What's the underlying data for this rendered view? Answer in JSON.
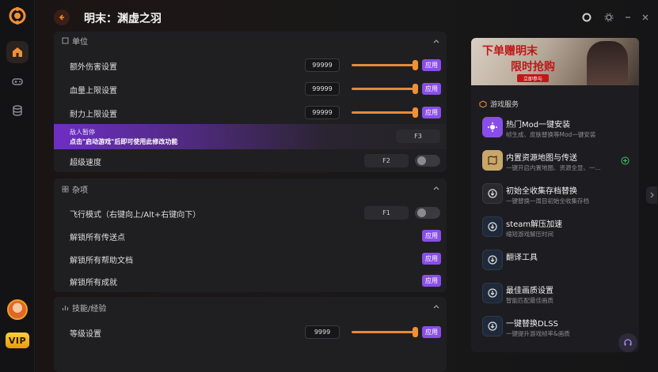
{
  "colors": {
    "accent": "#8a4ee8",
    "slider": "#e58a3a",
    "brand": "#f29035"
  },
  "header": {
    "title": "明末：渊虚之羽"
  },
  "sidebar": {
    "vip_label": "VIP"
  },
  "sections": {
    "unit": {
      "title": "单位",
      "rows": [
        {
          "label": "额外伤害设置",
          "value": "99999",
          "apply": "应用",
          "level": 1.0
        },
        {
          "label": "血量上限设置",
          "value": "99999",
          "apply": "应用",
          "level": 1.0
        },
        {
          "label": "耐力上限设置",
          "value": "99999",
          "apply": "应用",
          "level": 1.0
        }
      ],
      "promo": {
        "line1": "敌人暂停",
        "line2": "点击\"启动游戏\"后即可使用此修改功能",
        "key": "F3"
      },
      "speed": {
        "label": "超级速度",
        "key": "F2",
        "on": false
      }
    },
    "misc": {
      "title": "杂项",
      "rows": [
        {
          "label": "飞行模式（右键向上/Alt+右键向下）",
          "key": "F1",
          "on": false
        },
        {
          "label": "解锁所有传送点",
          "apply": "应用"
        },
        {
          "label": "解锁所有帮助文档",
          "apply": "应用"
        },
        {
          "label": "解锁所有成就",
          "apply": "应用"
        }
      ]
    },
    "skill": {
      "title": "技能/经验",
      "rows": [
        {
          "label": "等级设置",
          "value": "9999",
          "apply": "应用",
          "level": 1.0
        }
      ]
    }
  },
  "right_panel": {
    "banner": {
      "line1": "下单赠明末",
      "line2": "限时抢购",
      "tag": "立即参与"
    },
    "heading": "游戏服务",
    "services": [
      {
        "name": "热门Mod一键安装",
        "desc": "帧生成、皮肤替换等Mod一键安装",
        "icon": "mod-icon"
      },
      {
        "name": "内置资源地图与传送",
        "desc": "一键开启内置地图、资源全显、一...",
        "icon": "map-icon"
      },
      {
        "name": "初始全收集存档替换",
        "desc": "一键替换一周目初始全收集存档",
        "icon": "save-icon"
      },
      {
        "name": "steam解压加速",
        "desc": "缩短游戏解压时间",
        "icon": "download-icon"
      },
      {
        "name": "翻译工具",
        "desc": "",
        "icon": "translate-icon"
      },
      {
        "name": "最佳画质设置",
        "desc": "智能匹配最佳画质",
        "icon": "quality-icon"
      },
      {
        "name": "一键替换DLSS",
        "desc": "一键提升游戏帧率&画质",
        "icon": "dlss-icon"
      }
    ]
  }
}
